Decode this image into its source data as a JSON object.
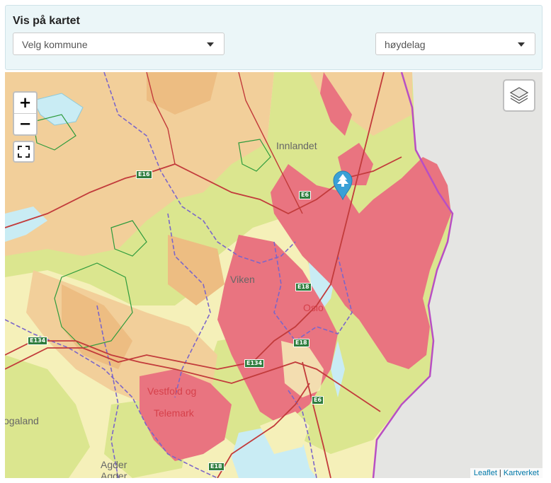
{
  "panel": {
    "title": "Vis på kartet",
    "kommune_select": "Velg kommune",
    "layer_select": "høydelag"
  },
  "map": {
    "zoom_in": "+",
    "zoom_out": "−",
    "labels": {
      "innlandet": "Innlandet",
      "viken": "Viken",
      "oslo": "Oslo",
      "vestfold_1": "Vestfold og",
      "vestfold_2": "Telemark",
      "rogaland": "ogaland",
      "agder_1": "Agder",
      "agder_2": "Agder"
    },
    "roads": {
      "e16": "E16",
      "e6a": "E6",
      "e18a": "E18",
      "e18b": "E18",
      "e134a": "E134",
      "e134b": "E134",
      "e6b": "E6",
      "e18c": "E18"
    },
    "attribution": {
      "leaflet": "Leaflet",
      "separator": " | ",
      "kartverket": "Kartverket"
    },
    "colors": {
      "lowland": "#f5f0b9",
      "green": "#dbe68f",
      "tan": "#f2cf9a",
      "orange": "#edbd82",
      "pink": "#e97480",
      "water": "#c9ecf4",
      "sweden": "#e5e5e3",
      "border_purple": "#b84fc4",
      "marker": "#3aa0d6"
    }
  }
}
